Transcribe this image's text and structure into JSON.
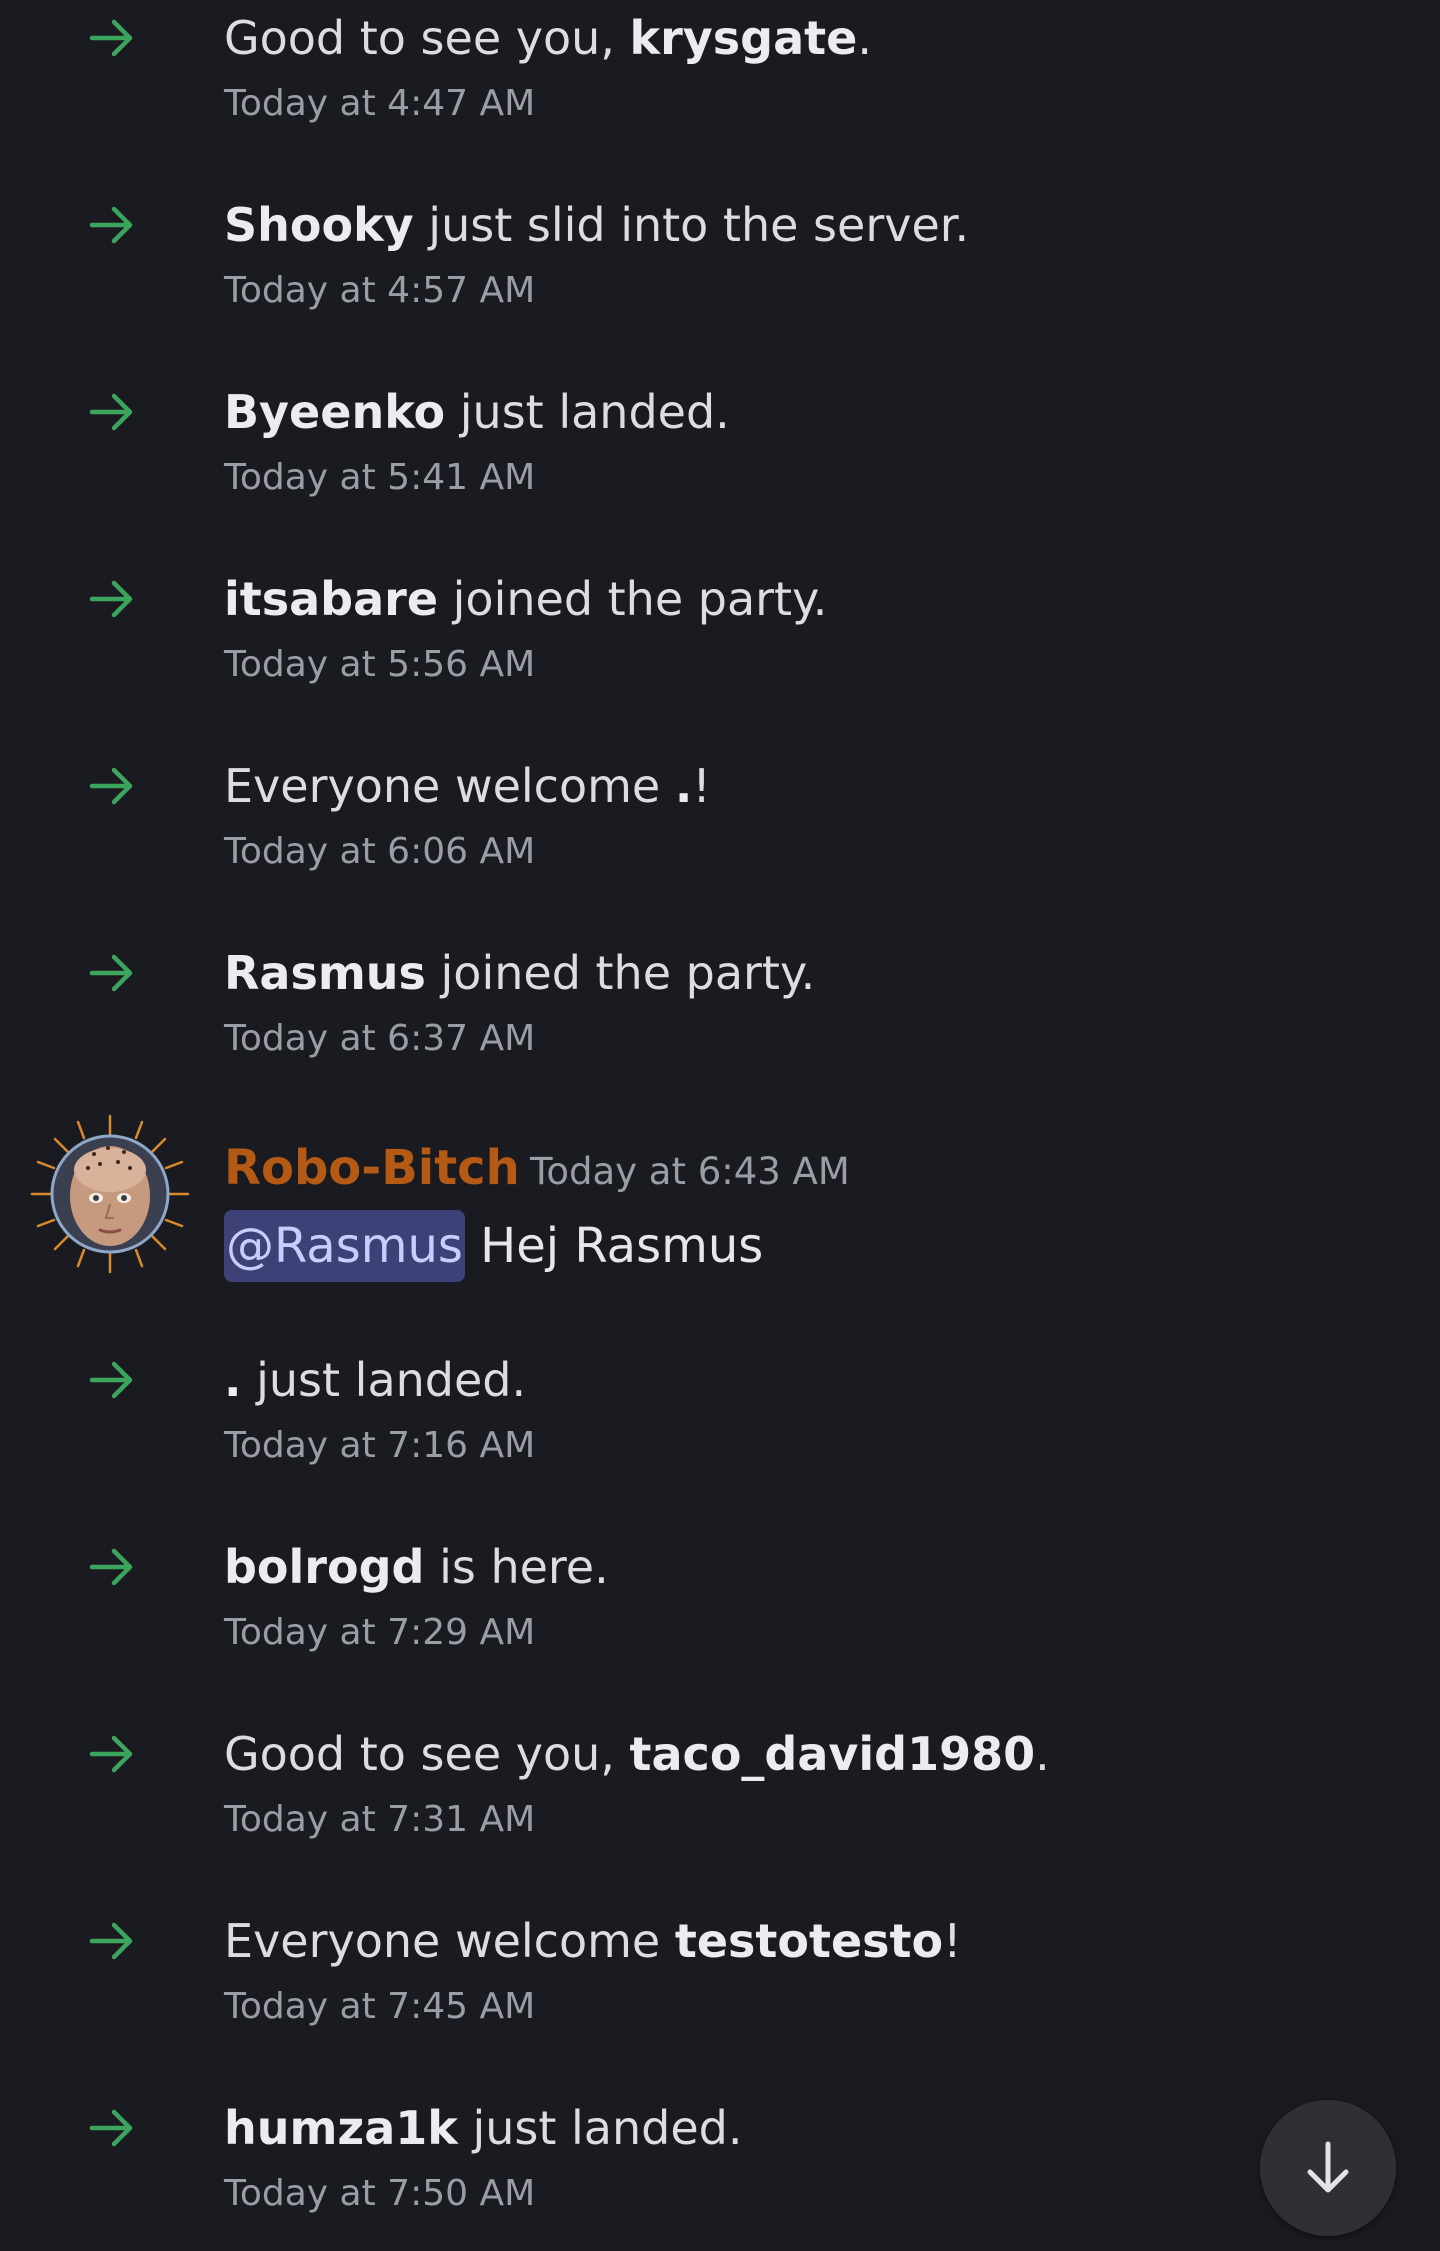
{
  "colors": {
    "background": "#1a1b20",
    "join_arrow": "#3ba55d",
    "author_robo": "#b45a14",
    "mention_bg": "#3d4178",
    "mention_text": "#c9cdfb",
    "timestamp": "#9a9ca6"
  },
  "icons": {
    "join": "arrow-right-icon",
    "scroll": "arrow-down-icon"
  },
  "feed": {
    "items": [
      {
        "pre": "Good to see you, ",
        "name": "krysgate",
        "post": ".",
        "time": "Today at 4:47 AM"
      },
      {
        "pre": "",
        "name": "Shooky",
        "post": " just slid into the server.",
        "time": "Today at 4:57 AM"
      },
      {
        "pre": "",
        "name": "Byeenko",
        "post": " just landed.",
        "time": "Today at 5:41 AM"
      },
      {
        "pre": "",
        "name": "itsabare",
        "post": " joined the party.",
        "time": "Today at 5:56 AM"
      },
      {
        "pre": "Everyone welcome ",
        "name": ".",
        "post": "!",
        "time": "Today at 6:06 AM"
      },
      {
        "pre": "",
        "name": "Rasmus",
        "post": " joined the party.",
        "time": "Today at 6:37 AM"
      }
    ],
    "message": {
      "author": "Robo-Bitch",
      "time": "Today at 6:43 AM",
      "mention": "@Rasmus",
      "text": " Hej Rasmus"
    },
    "items_after": [
      {
        "pre": "",
        "name": ".",
        "post": " just landed.",
        "time": "Today at 7:16 AM"
      },
      {
        "pre": "",
        "name": "bolrogd",
        "post": " is here.",
        "time": "Today at 7:29 AM"
      },
      {
        "pre": "Good to see you, ",
        "name": "taco_david1980",
        "post": ".",
        "time": "Today at 7:31 AM"
      },
      {
        "pre": "Everyone welcome ",
        "name": "testotesto",
        "post": "!",
        "time": "Today at 7:45 AM"
      },
      {
        "pre": "",
        "name": "humza1k",
        "post": " just landed.",
        "time": "Today at 7:50 AM"
      }
    ]
  }
}
